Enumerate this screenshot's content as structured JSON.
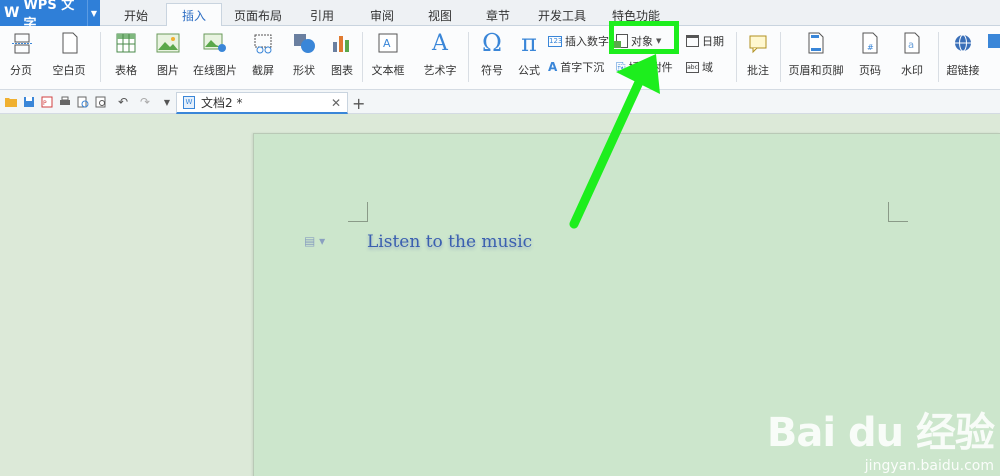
{
  "app": {
    "title": "WPS 文字"
  },
  "tabs": [
    "开始",
    "插入",
    "页面布局",
    "引用",
    "审阅",
    "视图",
    "章节",
    "开发工具",
    "特色功能"
  ],
  "active_tab": "插入",
  "ribbon": {
    "page_break": "分页",
    "blank_page": "空白页",
    "table": "表格",
    "picture": "图片",
    "online_picture": "在线图片",
    "screenshot": "截屏",
    "shape": "形状",
    "chart": "图表",
    "textbox": "文本框",
    "wordart": "艺术字",
    "symbol": "符号",
    "formula": "公式",
    "insert_number": "插入数字",
    "drop_cap": "首字下沉",
    "object": "对象",
    "attachment": "插入附件",
    "date": "日期",
    "field": "域",
    "comment": "批注",
    "header_footer": "页眉和页脚",
    "page_number": "页码",
    "watermark": "水印",
    "hyperlink": "超链接"
  },
  "document": {
    "tab_name": "文档2 *",
    "body_text": "Listen to the music"
  },
  "watermark": {
    "brand": "Bai du 经验",
    "url": "jingyan.baidu.com"
  },
  "colors": {
    "highlight": "#1dee1d",
    "accent": "#2f7fd8",
    "page_bg": "#cce6cc"
  }
}
